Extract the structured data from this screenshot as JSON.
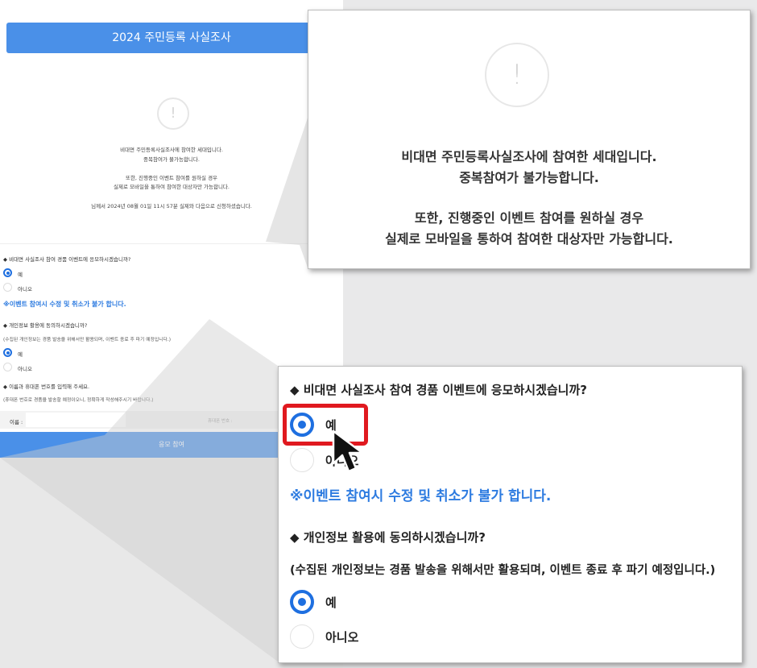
{
  "left_page": {
    "header_title": "2024 주민등록 사실조사",
    "alert_icon": "!",
    "message": {
      "line1": "비대면 주민등록사실조사에 참여한 세대입니다.",
      "line2": "중복참여가 불가능합니다.",
      "line3": "또한, 진행중인 이벤트 참여를 원하실 경우",
      "line4": "실제로 모바일을 통하여 참여한 대상자만 가능합니다.",
      "line5": "님께서 2024년 08월 01일 11시 57분 실제와 다음으로 신청하셨습니다."
    },
    "q1": "◆ 비대면 사실조사 참여 경품 이벤트에 응모하시겠습니까?",
    "q1_yes": "예",
    "q1_no": "아니오",
    "notice": "※이벤트 참여시 수정 및 취소가 불가 합니다.",
    "q2": "◆ 개인정보 활용에 동의하시겠습니까?",
    "q2_note": "(수집된 개인정보는 경품 발송을 위해서만 활용되며, 이벤트 종료 후 파기 예정입니다.)",
    "q2_yes": "예",
    "q2_no": "아니오",
    "q3": "◆ 이름과 휴대폰 번호를 입력해 주세요.",
    "q3_note": "(휴대폰 번호로 경품을 발송할 예정이오니, 정확하게 작성해주시기 바랍니다.)",
    "name_label": "이름 :",
    "phone_label": "휴대폰 번호 :",
    "submit_label": "응모 참여"
  },
  "zoom_panel_1": {
    "alert_icon": "!",
    "line1": "비대면 주민등록사실조사에 참여한 세대입니다.",
    "line2": "중복참여가 불가능합니다.",
    "line3": "또한, 진행중인 이벤트 참여를 원하실 경우",
    "line4": "실제로 모바일을 통하여 참여한 대상자만 가능합니다."
  },
  "zoom_panel_2": {
    "q1": "◆ 비대면 사실조사 참여 경품 이벤트에 응모하시겠습니까?",
    "q1_yes": "예",
    "q1_no": "아니오",
    "notice": "※이벤트 참여시 수정 및 취소가 불가 합니다.",
    "q2": "◆ 개인정보 활용에 동의하시겠습니까?",
    "q2_note": "(수집된 개인정보는 경품 발송을 위해서만 활용되며, 이벤트 종료 후 파기 예정입니다.)",
    "q2_yes": "예",
    "q2_no": "아니오"
  },
  "colors": {
    "accent": "#4a90e8",
    "radio": "#1e6fe0",
    "notice": "#2d7be0",
    "highlight": "#e0191f"
  }
}
